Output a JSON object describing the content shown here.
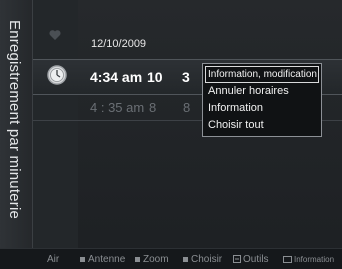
{
  "side_title": "Enregistrement par minuterie",
  "date": "12/10/2009",
  "rows": [
    {
      "time": "4:34 am",
      "ch": "10",
      "sub": "3",
      "selected": true
    },
    {
      "time": "4 : 35 am",
      "ch": "8",
      "sub": "8",
      "selected": false
    }
  ],
  "menu": {
    "items": [
      "Information, modification",
      "Annuler horaires",
      "Information",
      "Choisir tout"
    ]
  },
  "bottom": {
    "air": "Air",
    "antenne": "Antenne",
    "zoom": "Zoom",
    "choisir": "Choisir",
    "outils": "Outils",
    "information": "Information"
  },
  "icons": {
    "heart": "heart-icon",
    "clock": "clock-icon",
    "outils": "tools-icon",
    "information": "info-icon"
  }
}
